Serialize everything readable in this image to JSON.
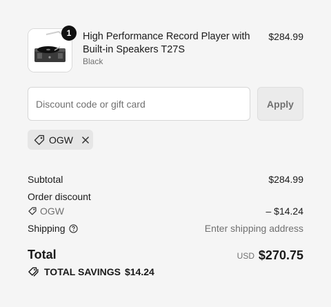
{
  "line_item": {
    "quantity": "1",
    "title": "High Performance Record Player with Built-in Speakers T27S",
    "variant": "Black",
    "price": "$284.99",
    "image_icon": "record-player-thumbnail"
  },
  "discount": {
    "placeholder": "Discount code or gift card",
    "value": "",
    "apply_label": "Apply",
    "applied_code": "OGW"
  },
  "summary": {
    "subtotal_label": "Subtotal",
    "subtotal_value": "$284.99",
    "order_discount_label": "Order discount",
    "discount_code": "OGW",
    "discount_value": "– $14.24",
    "shipping_label": "Shipping",
    "shipping_value": "Enter shipping address",
    "total_label": "Total",
    "currency": "USD",
    "total_value": "$270.75",
    "savings_label": "TOTAL SAVINGS",
    "savings_value": "$14.24"
  }
}
